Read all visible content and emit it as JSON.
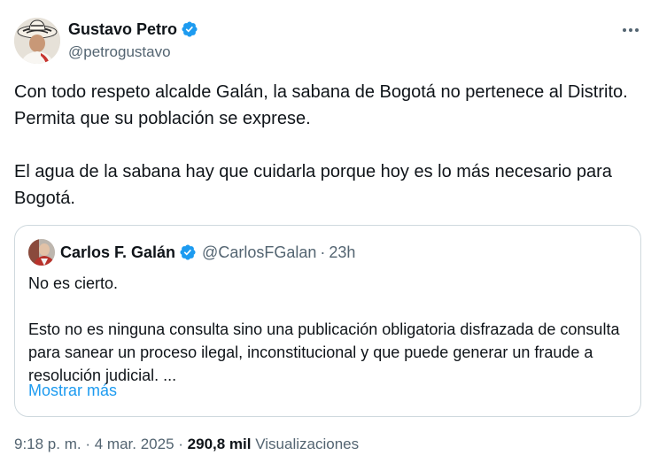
{
  "author": {
    "name": "Gustavo Petro",
    "handle": "@petrogustavo",
    "verified_color": "#1d9bf0"
  },
  "tweet": {
    "paragraph1": "Con todo respeto alcalde Galán, la sabana de Bogotá no pertenece al Distrito. Permita que su población se exprese.",
    "paragraph2": "El agua de la sabana hay que cuidarla porque hoy es lo más necesario para Bogotá."
  },
  "quoted": {
    "name": "Carlos F. Galán",
    "handle": "@CarlosFGalan",
    "separator": "·",
    "time": "23h",
    "paragraph1": "No es cierto.",
    "paragraph2": "Esto no es ninguna consulta sino una publicación obligatoria disfrazada de consulta para sanear un proceso ilegal, inconstitucional y que puede generar un fraude a resolución judicial. ...",
    "show_more": "Mostrar más"
  },
  "meta": {
    "time": "9:18 p. m.",
    "separator": "·",
    "date": "4 mar. 2025",
    "views_count": "290,8 mil",
    "views_label": "Visualizaciones"
  },
  "icons": {
    "more": "more-horizontal-icon",
    "verified": "verified-badge-icon"
  },
  "colors": {
    "text": "#0f1419",
    "secondary": "#536471",
    "link": "#1d9bf0",
    "border": "#cfd9de"
  }
}
